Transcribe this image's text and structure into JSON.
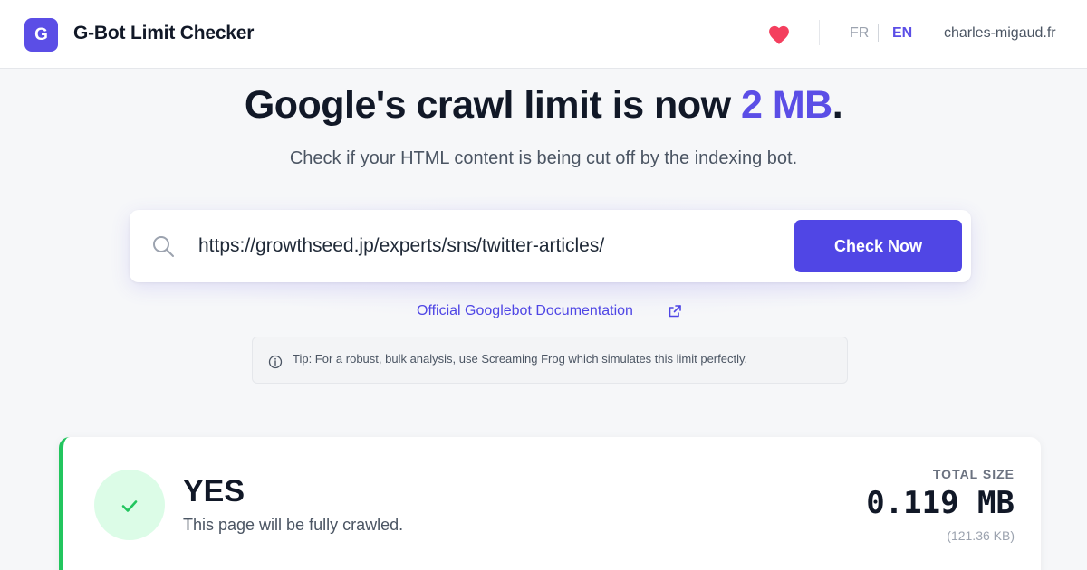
{
  "header": {
    "logo_letter": "G",
    "app_title": "G-Bot Limit Checker",
    "lang_fr": "FR",
    "lang_en": "EN",
    "site_link": "charles-migaud.fr"
  },
  "hero": {
    "title_prefix": "Google's crawl limit is now ",
    "title_accent": "2 MB",
    "title_suffix": ".",
    "subtitle": "Check if your HTML content is being cut off by the indexing bot."
  },
  "search": {
    "value": "https://growthseed.jp/experts/sns/twitter-articles/",
    "button_label": "Check Now"
  },
  "doc_link": "Official Googlebot Documentation",
  "tip": "Tip: For a robust, bulk analysis, use Screaming Frog which simulates this limit perfectly.",
  "result": {
    "verdict": "YES",
    "description": "This page will be fully crawled.",
    "size_label": "TOTAL SIZE",
    "size_value": "0.119 MB",
    "size_kb": "(121.36 KB)",
    "status": "success"
  },
  "colors": {
    "accent": "#5b4ee6",
    "success": "#22c55e",
    "heart": "#f43f5e"
  },
  "icons": [
    "logo-badge",
    "heart-icon",
    "search-icon",
    "external-link-icon",
    "info-icon",
    "check-icon"
  ]
}
